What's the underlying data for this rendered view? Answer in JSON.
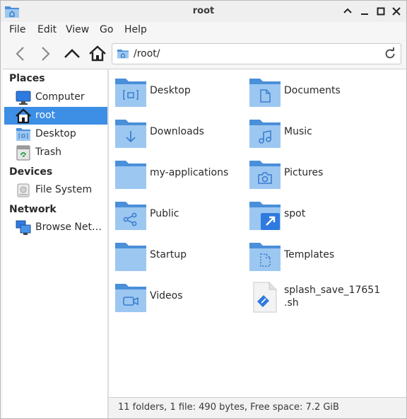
{
  "window": {
    "title": "root"
  },
  "menu": {
    "items": [
      "File",
      "Edit",
      "View",
      "Go",
      "Help"
    ]
  },
  "location": {
    "path": "/root/"
  },
  "sidebar": {
    "places_heading": "Places",
    "places": [
      "Computer",
      "root",
      "Desktop",
      "Trash"
    ],
    "devices_heading": "Devices",
    "devices": [
      "File System"
    ],
    "network_heading": "Network",
    "network": [
      "Browse Net…"
    ]
  },
  "files": [
    {
      "name": "Desktop",
      "icon": "desktop-folder-icon"
    },
    {
      "name": "Documents",
      "icon": "documents-folder-icon"
    },
    {
      "name": "Downloads",
      "icon": "downloads-folder-icon"
    },
    {
      "name": "Music",
      "icon": "music-folder-icon"
    },
    {
      "name": "my-applications",
      "icon": "folder-icon"
    },
    {
      "name": "Pictures",
      "icon": "pictures-folder-icon"
    },
    {
      "name": "Public",
      "icon": "public-folder-icon"
    },
    {
      "name": "spot",
      "icon": "symlink-folder-icon"
    },
    {
      "name": "Startup",
      "icon": "folder-icon"
    },
    {
      "name": "Templates",
      "icon": "templates-folder-icon"
    },
    {
      "name": "Videos",
      "icon": "videos-folder-icon"
    },
    {
      "name_line1": "splash_save_17651",
      "name_line2": ".sh",
      "icon": "shell-script-icon"
    }
  ],
  "status": {
    "text": "11 folders, 1 file: 490 bytes, Free space: 7.2 GiB"
  },
  "colors": {
    "accent": "#3d8ee5",
    "folder_back": "#4a8fd9",
    "folder_front": "#9cc7f1"
  }
}
